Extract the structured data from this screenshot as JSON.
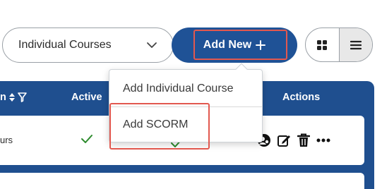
{
  "toolbar": {
    "course_type_select": {
      "selected": "Individual Courses"
    },
    "add_new_label": "Add New",
    "add_new_icon": "plus-icon",
    "view_toggle": [
      {
        "icon": "grid-view-icon",
        "active": false
      },
      {
        "icon": "list-view-icon",
        "active": true
      }
    ]
  },
  "table": {
    "headers": {
      "partial": "n",
      "active": "Active",
      "actions": "Actions"
    },
    "rows": [
      {
        "partial_text": "urs",
        "active": true,
        "actions": [
          "assign-icon",
          "edit-icon",
          "delete-icon",
          "more-icon"
        ]
      }
    ]
  },
  "dropdown": {
    "items": [
      "Add Individual Course",
      "Add SCORM"
    ]
  },
  "colors": {
    "primary": "#1f5296",
    "table_header": "#1f4f8f",
    "highlight": "#e2584f",
    "check": "#2e8b2e"
  }
}
